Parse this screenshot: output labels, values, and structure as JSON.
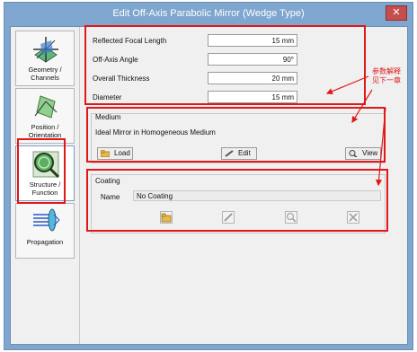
{
  "window": {
    "title": "Edit Off-Axis Parabolic Mirror (Wedge Type)",
    "close_label": "✕"
  },
  "sidebar": {
    "items": [
      {
        "label": "Geometry / Channels"
      },
      {
        "label": "Position / Orientation"
      },
      {
        "label": "Structure / Function",
        "selected": true
      },
      {
        "label": "Propagation"
      }
    ]
  },
  "params": [
    {
      "label": "Reflected Focal Length",
      "value": "15 mm"
    },
    {
      "label": "Off-Axis Angle",
      "value": "90°"
    },
    {
      "label": "Overall Thickness",
      "value": "20 mm"
    },
    {
      "label": "Diameter",
      "value": "15 mm"
    }
  ],
  "medium": {
    "group_title": "Medium",
    "description": "Ideal Mirror in Homogeneous Medium",
    "load_label": "Load",
    "edit_label": "Edit",
    "view_label": "View"
  },
  "coating": {
    "group_title": "Coating",
    "name_label": "Name",
    "name_value": "No Coating"
  },
  "annotation": {
    "line1": "参数解释",
    "line2": "见下一章"
  },
  "colors": {
    "title_bar": "#7ea6cf",
    "highlight_red": "#e01818",
    "panel_bg": "#f0f0f0"
  }
}
